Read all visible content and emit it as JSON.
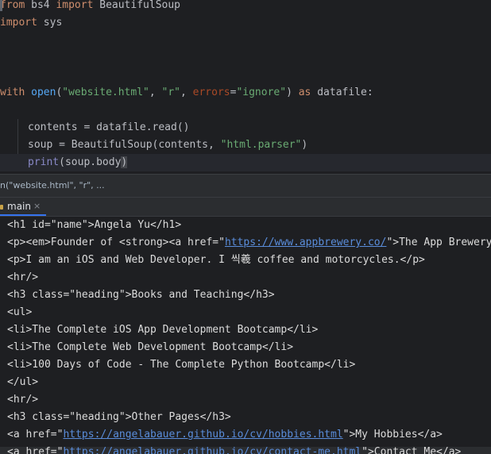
{
  "editor": {
    "lines": [
      {
        "kw1": "from",
        "t1": " bs4 ",
        "kw2": "import",
        "t2": " BeautifulSoup"
      },
      {
        "kw1": "import",
        "t1": " sys"
      },
      {},
      {},
      {
        "kw1": "with",
        "t1": " ",
        "fn1": "open",
        "t2": "(",
        "s1": "\"website.html\"",
        "t3": ", ",
        "s2": "\"r\"",
        "t4": ", ",
        "p1": "errors",
        "t5": "=",
        "s3": "\"ignore\"",
        "t6": ") ",
        "kw2": "as",
        "t7": " datafile:"
      },
      {},
      {
        "t1": "contents = datafile.read()"
      },
      {
        "t1": "soup = BeautifulSoup(contents, ",
        "s1": "\"html.parser\"",
        "t2": ")"
      },
      {
        "bi1": "print",
        "t1": "(soup.body",
        "t2": ")"
      }
    ]
  },
  "breadcrumb": {
    "text": "n(\"website.html\", \"r\", ..."
  },
  "run_panel": {
    "tab_label": "main",
    "tab_close": "×"
  },
  "console": {
    "lines": [
      {
        "pre": "<h1 id=\"name\">Angela Yu</h1>"
      },
      {
        "pre": "<p><em>Founder of <strong><a href=\"",
        "link": "https://www.appbrewery.co/",
        "post": "\">The App Brewery"
      },
      {
        "pre": "<p>I am an iOS and Web Developer. I 씩羲 coffee and motorcycles.</p>"
      },
      {
        "pre": "<hr/>"
      },
      {
        "pre": "<h3 class=\"heading\">Books and Teaching</h3>"
      },
      {
        "pre": "<ul>"
      },
      {
        "pre": "<li>The Complete iOS App Development Bootcamp</li>"
      },
      {
        "pre": "<li>The Complete Web Development Bootcamp</li>"
      },
      {
        "pre": "<li>100 Days of Code - The Complete Python Bootcamp</li>"
      },
      {
        "pre": "</ul>"
      },
      {
        "pre": "<hr/>"
      },
      {
        "pre": "<h3 class=\"heading\">Other Pages</h3>"
      },
      {
        "pre": "<a href=\"",
        "link": "https://angelabauer.github.io/cv/hobbies.html",
        "post": "\">My Hobbies</a>"
      },
      {
        "pre": "<a href=\"",
        "link": "https://angelabauer.github.io/cv/contact-me.html",
        "post": "\">Contact Me</a>"
      }
    ]
  },
  "colors": {
    "background": "#1e1f22",
    "keyword": "#cf8e6d",
    "string": "#6aab73",
    "link": "#5a8ddb",
    "accent": "#3574f0"
  }
}
